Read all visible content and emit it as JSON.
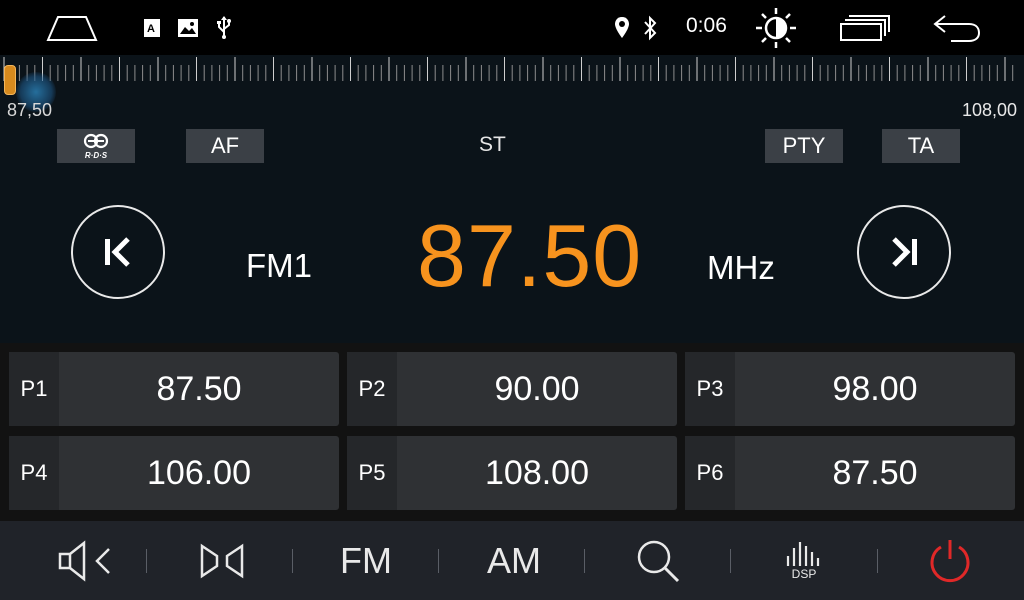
{
  "status_bar": {
    "clock": "0:06",
    "icons": [
      "home-icon",
      "font-app-icon",
      "gallery-icon",
      "usb-icon",
      "location-icon",
      "bluetooth-icon",
      "brightness-icon",
      "recent-apps-icon",
      "back-icon"
    ]
  },
  "tuner": {
    "range_min": "87,50",
    "range_max": "108,00",
    "rds_label": "R·D·S",
    "af_label": "AF",
    "stereo_label": "ST",
    "pty_label": "PTY",
    "ta_label": "TA",
    "band": "FM1",
    "frequency": "87.50",
    "unit": "MHz",
    "tuning_position": 0
  },
  "presets": [
    {
      "label": "P1",
      "freq": "87.50"
    },
    {
      "label": "P2",
      "freq": "90.00"
    },
    {
      "label": "P3",
      "freq": "98.00"
    },
    {
      "label": "P4",
      "freq": "106.00"
    },
    {
      "label": "P5",
      "freq": "108.00"
    },
    {
      "label": "P6",
      "freq": "87.50"
    }
  ],
  "bottom_bar": {
    "fm_label": "FM",
    "am_label": "AM",
    "dsp_label": "DSP",
    "accent_power": "#e02828"
  },
  "colors": {
    "frequency": "#f7931e",
    "background": "#0b1319"
  }
}
